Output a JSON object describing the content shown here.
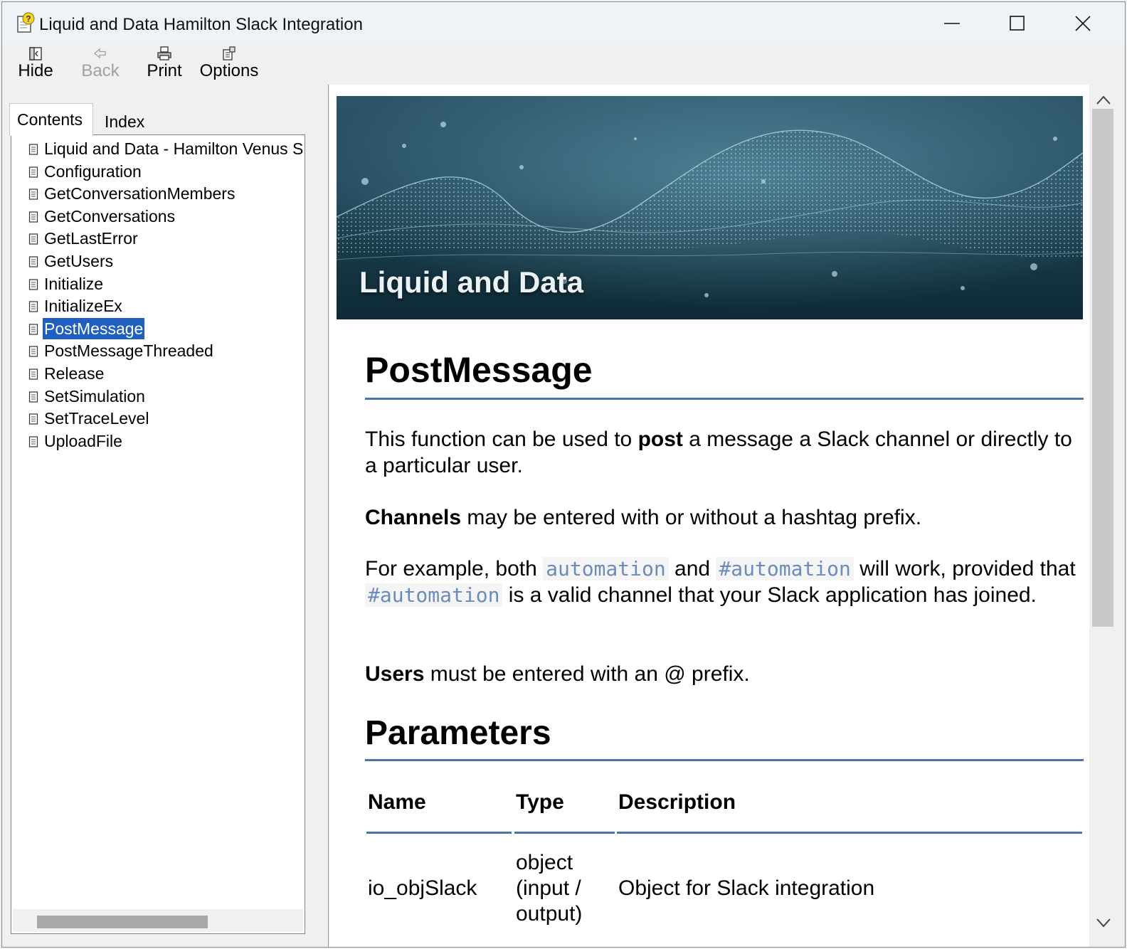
{
  "window": {
    "title": "Liquid and Data Hamilton Slack Integration"
  },
  "toolbar": {
    "hide_label": "Hide",
    "back_label": "Back",
    "print_label": "Print",
    "options_label": "Options"
  },
  "nav": {
    "tabs": [
      {
        "label": "Contents",
        "active": true
      },
      {
        "label": "Index",
        "active": false
      }
    ],
    "items": [
      {
        "label": "Liquid and Data - Hamilton Venus S"
      },
      {
        "label": "Configuration"
      },
      {
        "label": "GetConversationMembers"
      },
      {
        "label": "GetConversations"
      },
      {
        "label": "GetLastError"
      },
      {
        "label": "GetUsers"
      },
      {
        "label": "Initialize"
      },
      {
        "label": "InitializeEx"
      },
      {
        "label": "PostMessage",
        "selected": true
      },
      {
        "label": "PostMessageThreaded"
      },
      {
        "label": "Release"
      },
      {
        "label": "SetSimulation"
      },
      {
        "label": "SetTraceLevel"
      },
      {
        "label": "UploadFile"
      }
    ]
  },
  "content": {
    "banner_title": "Liquid and Data",
    "heading": "PostMessage",
    "intro_before": "This function can be used to ",
    "intro_bold": "post",
    "intro_after": " a message a Slack channel or directly to a particular user.",
    "channels_bold": "Channels",
    "channels_text": " may be entered with or without a hashtag prefix.",
    "example_1": "For example, both ",
    "example_code_1": "automation",
    "example_2": " and ",
    "example_code_2": "#automation",
    "example_3": " will work, provided that ",
    "example_code_3": "#automation",
    "example_4": " is a valid channel that your Slack application has joined.",
    "users_bold": "Users",
    "users_text": " must be entered with an @ prefix.",
    "params_heading": "Parameters",
    "table": {
      "headers": [
        "Name",
        "Type",
        "Description"
      ],
      "rows": [
        {
          "name": "io_objSlack",
          "type_lines": [
            "object",
            "(input /",
            "output)"
          ],
          "description": "Object for Slack integration"
        }
      ]
    }
  },
  "colors": {
    "accent_rule": "#4d74a8",
    "selection": "#1f5fbf",
    "code_text": "#6b8cba"
  }
}
